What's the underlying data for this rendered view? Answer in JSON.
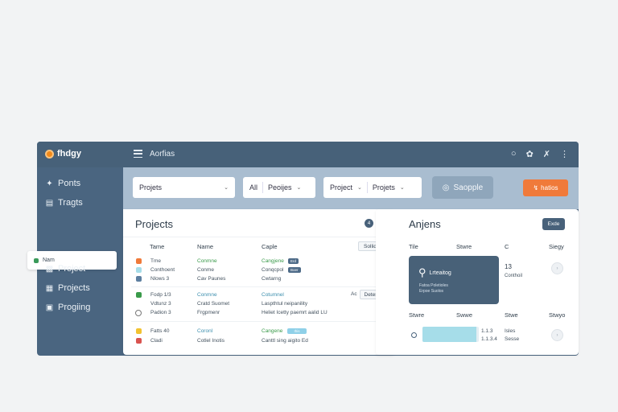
{
  "app": {
    "name": "fhdgy",
    "section_title": "Aorfias"
  },
  "colors": {
    "topbar": "#476179",
    "sidebar": "#4a6580",
    "filterbar": "#a9bdd0",
    "accent": "#f07a3a",
    "success": "#3a9a4a"
  },
  "sidebar": {
    "items": [
      {
        "label": "Ponts",
        "icon": "pin-icon"
      },
      {
        "label": "Tragts",
        "icon": "document-icon"
      },
      {
        "label": "Nam",
        "icon": "status-icon",
        "active": true
      },
      {
        "label": "Project",
        "icon": "bar-chart-icon"
      },
      {
        "label": "Projects",
        "icon": "grid-icon"
      },
      {
        "label": "Progiing",
        "icon": "list-icon"
      }
    ]
  },
  "filters": [
    {
      "label": "Projets"
    },
    {
      "label": "All"
    },
    {
      "label": "Peoijes"
    },
    {
      "label": "Project"
    },
    {
      "label": "Projets"
    }
  ],
  "buttons": {
    "sample": "Saopple",
    "action": "hatios"
  },
  "projects_panel": {
    "title": "Projects",
    "badge": "4",
    "columns": [
      "Tame",
      "Name",
      "Caple"
    ],
    "header_button": "Sollid",
    "group2_button": "Detes",
    "group2_extra": "Ac",
    "rows": [
      {
        "tame": "Tme",
        "name": "Conmne",
        "caple": "Cangjene",
        "pill": "Erd"
      },
      {
        "tame": "Conthoent",
        "name": "Conme",
        "caple": "Conqcpol",
        "pill": "Boer"
      },
      {
        "tame": "Nlows 3",
        "name": "Cav Paunes",
        "caple": "Cwtarng"
      },
      {
        "tame": "Fodp 1/3",
        "name": "Conmne",
        "caple": "Cotumnel"
      },
      {
        "tame": "Vdtunz 3",
        "name": "Cratd Suomet",
        "caple": "Laspthtul neipanility"
      },
      {
        "tame": "Padion 3",
        "name": "Frgpmenr",
        "caple": "Heliet Icetty paemrt aalid LU"
      },
      {
        "tame": "Fatts 40",
        "name": "Coronl",
        "caple": "Cangene",
        "pill": "Ihis"
      },
      {
        "tame": "Cladi",
        "name": "Cotlel Inotis",
        "caple": "Canttl sing aigito Ed"
      }
    ]
  },
  "right_panel": {
    "title": "Anjens",
    "button": "Exde",
    "columns": [
      "Tile",
      "Stwre",
      "C",
      "Siegy"
    ],
    "card_title": "Lrteaitog",
    "card_sub1": "Fatoa Poletioles",
    "card_sub2": "Erpoe Suolos",
    "side_value": "13",
    "side_label": "Conthoil",
    "columns2": [
      "Stwre",
      "Swwe",
      "Stwe",
      "Stwyo"
    ],
    "progress_fraction": 0.95,
    "progress_values": [
      "1.1.3",
      "1.1.3.4"
    ],
    "progress_labels": [
      "Isles",
      "Sesse"
    ]
  }
}
